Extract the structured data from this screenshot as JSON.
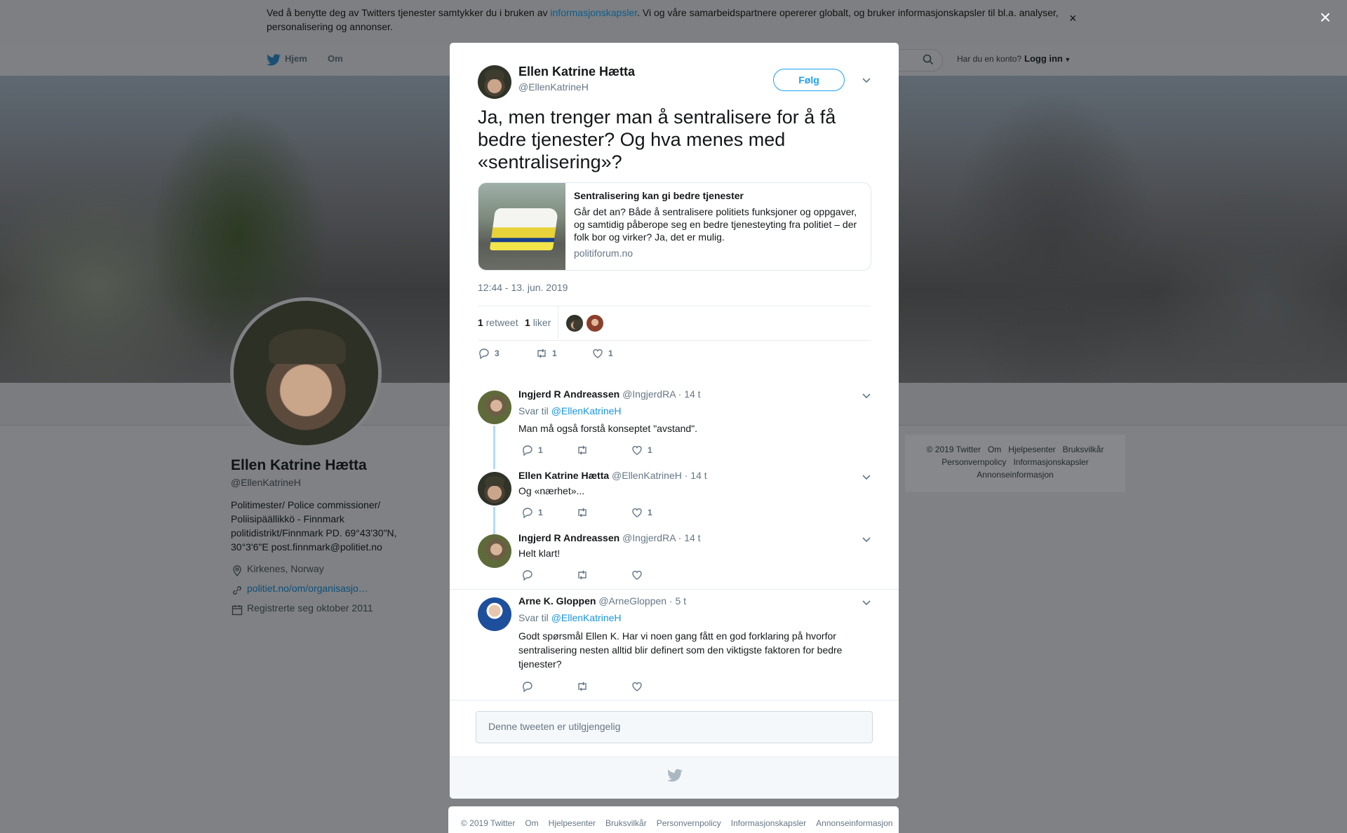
{
  "cookie_banner": {
    "text_before": "Ved å benytte deg av Twitters tjenester samtykker du i bruken av ",
    "link": "informasjonskapsler",
    "text_after": ". Vi og våre samarbeidspartnere opererer globalt, og bruker informasjonskapsler til bl.a. analyser, personalisering og annonser.",
    "close": "×"
  },
  "nav": {
    "home": "Hjem",
    "about": "Om",
    "account_prompt": "Har du en konto?",
    "login": "Logg inn"
  },
  "profile": {
    "name": "Ellen Katrine Hætta",
    "handle": "@EllenKatrineH",
    "bio": "Politimester/ Police commissioner/ Poliisipäällikkö - Finnmark politidistrikt/Finnmark PD. 69°43'30\"N, 30°3'6\"E post.finnmark@politiet.no",
    "location": "Kirkenes, Norway",
    "website": "politiet.no/om/organisasjo…",
    "joined": "Registrerte seg oktober 2011"
  },
  "side_footer": [
    "© 2019 Twitter",
    "Om",
    "Hjelpesenter",
    "Bruksvilkår",
    "Personvernpolicy",
    "Informasjonskapsler",
    "Annonseinformasjon"
  ],
  "overlay_close": "×",
  "tweet": {
    "author_name": "Ellen Katrine Hætta",
    "author_handle": "@EllenKatrineH",
    "follow": "Følg",
    "text": "Ja, men trenger man å sentralisere for å få bedre tjenester? Og hva menes med «sentralisering»?",
    "card": {
      "title": "Sentralisering kan gi bedre tjenester",
      "description": "Går det an? Både å sentralisere politiets funksjoner og oppgaver, og samtidig påberope seg en bedre tjenesteyting fra politiet – der folk bor og virker? Ja, det er mulig.",
      "domain": "politiforum.no"
    },
    "timestamp": "12:44 - 13. jun. 2019",
    "retweet_count": "1",
    "retweet_label": "retweet",
    "like_count": "1",
    "like_label": "liker",
    "actions": {
      "replies": "3",
      "retweets": "1",
      "likes": "1"
    }
  },
  "replies": [
    {
      "name": "Ingjerd R Andreassen",
      "handle": "@IngjerdRA",
      "time": "· 14 t",
      "reply_to_label": "Svar til",
      "reply_to": "@EllenKatrineH",
      "text": "Man må også forstå konseptet \"avstand\".",
      "replies": "1",
      "retweets": "",
      "likes": "1"
    },
    {
      "name": "Ellen Katrine Hætta",
      "handle": "@EllenKatrineH",
      "time": "· 14 t",
      "text": "Og «nærhet»...",
      "replies": "1",
      "retweets": "",
      "likes": "1"
    },
    {
      "name": "Ingjerd R Andreassen",
      "handle": "@IngjerdRA",
      "time": "· 14 t",
      "text": "Helt klart!",
      "replies": "",
      "retweets": "",
      "likes": ""
    },
    {
      "name": "Arne K. Gloppen",
      "handle": "@ArneGloppen",
      "time": "· 5 t",
      "reply_to_label": "Svar til",
      "reply_to": "@EllenKatrineH",
      "text": "Godt spørsmål Ellen K. Har vi noen gang fått en god forklaring på hvorfor sentralisering nesten alltid blir definert som den viktigste faktoren for bedre tjenester?",
      "replies": "",
      "retweets": "",
      "likes": ""
    }
  ],
  "unavailable": "Denne tweeten er utilgjengelig",
  "bottom_footer": [
    "© 2019 Twitter",
    "Om",
    "Hjelpesenter",
    "Bruksvilkår",
    "Personvernpolicy",
    "Informasjonskapsler",
    "Annonseinformasjon"
  ],
  "colors": {
    "accent": "#1da1f2",
    "link": "#1b95e0",
    "thread": "#b1dcf7"
  }
}
